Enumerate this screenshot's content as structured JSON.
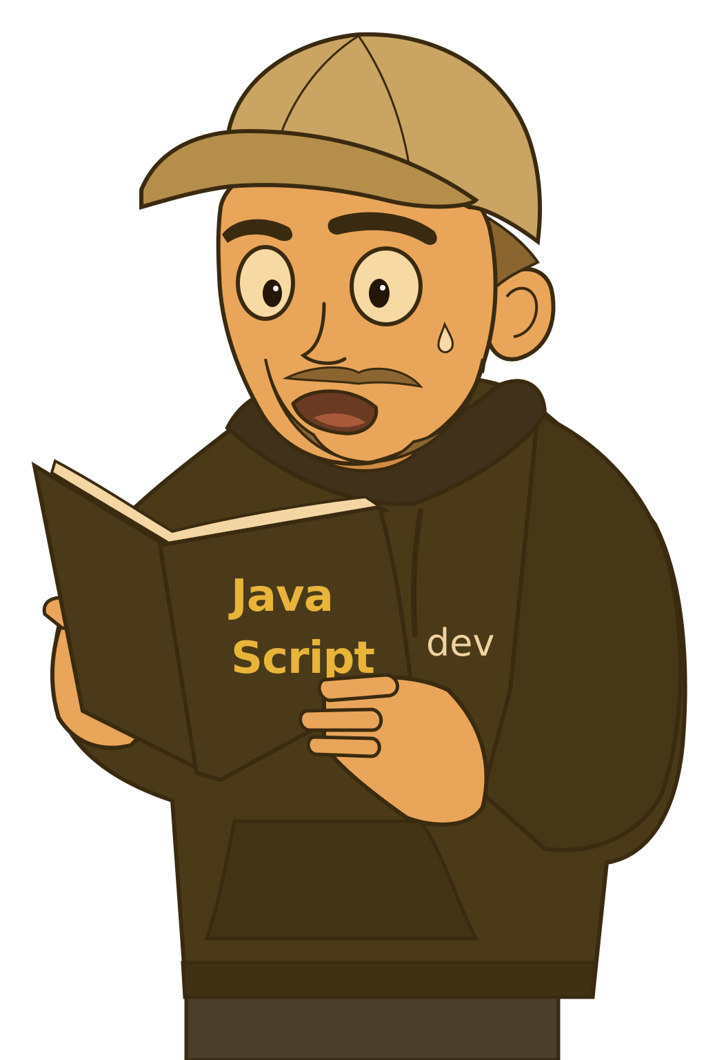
{
  "illustration": {
    "book": {
      "title_line1": "Java",
      "title_line2": "Script"
    },
    "hoodie": {
      "text": "dev"
    }
  },
  "colors": {
    "outline": "#3a2a10",
    "cap": "#c9a462",
    "cap_shadow": "#b58e4b",
    "skin": "#e9a55a",
    "skin_shadow": "#cf8a44",
    "beard": "#8a6530",
    "hoodie": "#4a3a17",
    "hoodie_shadow": "#3a2d11",
    "book_cover": "#4a3a1a",
    "book_pages": "#f3d6a3",
    "book_text": "#e8b43a",
    "hoodie_text": "#f1d3a3",
    "eye_white": "#f6d9a3"
  }
}
